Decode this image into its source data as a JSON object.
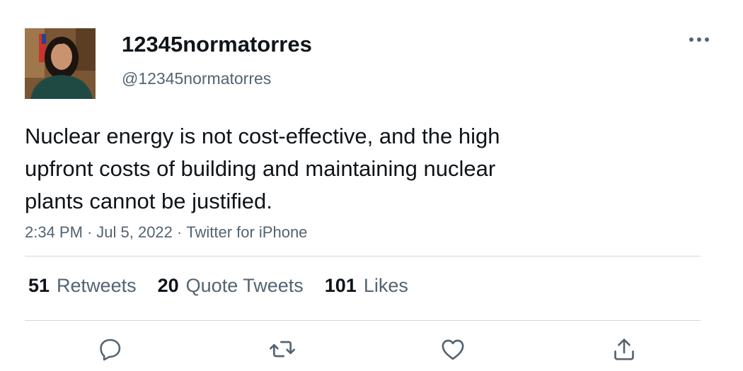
{
  "author": {
    "display_name": "12345normatorres",
    "handle": "@12345normatorres"
  },
  "tweet": {
    "text_lines": [
      "Nuclear energy is not cost-effective, and the high",
      "upfront costs of building and maintaining nuclear",
      "plants cannot be justified."
    ],
    "time": "2:34 PM",
    "date": "Jul 5, 2022",
    "source": "Twitter for iPhone",
    "separator": "·"
  },
  "stats": {
    "retweets": {
      "count": "51",
      "label": "Retweets"
    },
    "quote_tweets": {
      "count": "20",
      "label": "Quote Tweets"
    },
    "likes": {
      "count": "101",
      "label": "Likes"
    }
  },
  "icons": {
    "more": "more-horizontal-icon",
    "reply": "reply-icon",
    "retweet": "retweet-icon",
    "like": "heart-icon",
    "share": "share-icon"
  },
  "colors": {
    "primary_text": "#0f1419",
    "secondary_text": "#536471",
    "divider": "#cfd9de"
  }
}
